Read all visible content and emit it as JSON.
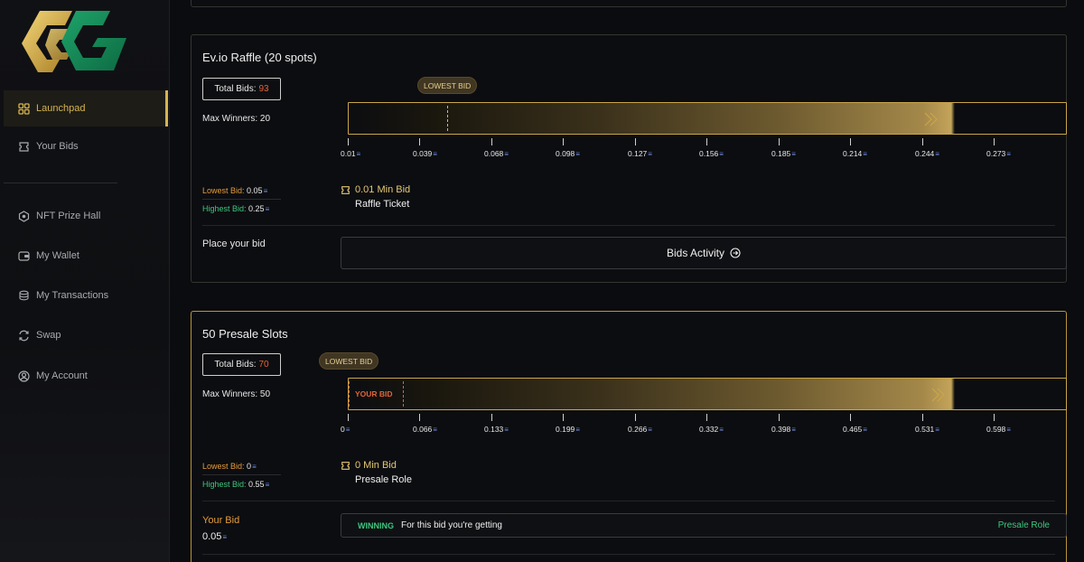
{
  "sidebar": {
    "items": [
      {
        "label": "Launchpad",
        "icon": "grid-icon",
        "active": true
      },
      {
        "label": "Your Bids",
        "icon": "ticket-icon",
        "active": false
      },
      {
        "label": "NFT Prize Hall",
        "icon": "hexagon-icon",
        "active": false
      },
      {
        "label": "My Wallet",
        "icon": "wallet-icon",
        "active": false
      },
      {
        "label": "My Transactions",
        "icon": "coins-icon",
        "active": false
      },
      {
        "label": "Swap",
        "icon": "swap-icon",
        "active": false
      },
      {
        "label": "My Account",
        "icon": "user-icon",
        "active": false
      }
    ]
  },
  "colors": {
    "gold": "#d6b451",
    "orange": "#e0643a",
    "green": "#3ec77f",
    "background": "#0b0c10"
  },
  "auctions": [
    {
      "title": "Ev.io Raffle (20 spots)",
      "total_bids_label": "Total Bids:",
      "total_bids": "93",
      "max_winners": "Max Winners: 20",
      "lowest_tag": "LOWEST BID",
      "ticks": [
        "0.01",
        "0.039",
        "0.068",
        "0.098",
        "0.127",
        "0.156",
        "0.185",
        "0.214",
        "0.244",
        "0.273"
      ],
      "lowest_bid_label": "Lowest Bid:",
      "lowest_bid": "0.05",
      "highest_bid_label": "Highest Bid:",
      "highest_bid": "0.25",
      "min_bid": "0.01 Min Bid",
      "reward": "Raffle Ticket",
      "place_bid": "Place your bid",
      "activity_button": "Bids Activity"
    },
    {
      "title": "50 Presale Slots",
      "total_bids_label": "Total Bids:",
      "total_bids": "70",
      "max_winners": "Max Winners: 50",
      "lowest_tag": "LOWEST BID",
      "your_bid_tag": "YOUR BID",
      "ticks": [
        "0",
        "0.066",
        "0.133",
        "0.199",
        "0.266",
        "0.332",
        "0.398",
        "0.465",
        "0.531",
        "0.598"
      ],
      "lowest_bid_label": "Lowest Bid:",
      "lowest_bid": "0",
      "highest_bid_label": "Highest Bid:",
      "highest_bid": "0.55",
      "min_bid": "0 Min Bid",
      "reward": "Presale Role",
      "your_bid_title": "Your Bid",
      "your_bid_value": "0.05",
      "winning_badge": "WINNING",
      "winning_desc": "For this bid you're getting",
      "winning_reward": "Presale Role"
    }
  ],
  "currency_symbol": "≡"
}
